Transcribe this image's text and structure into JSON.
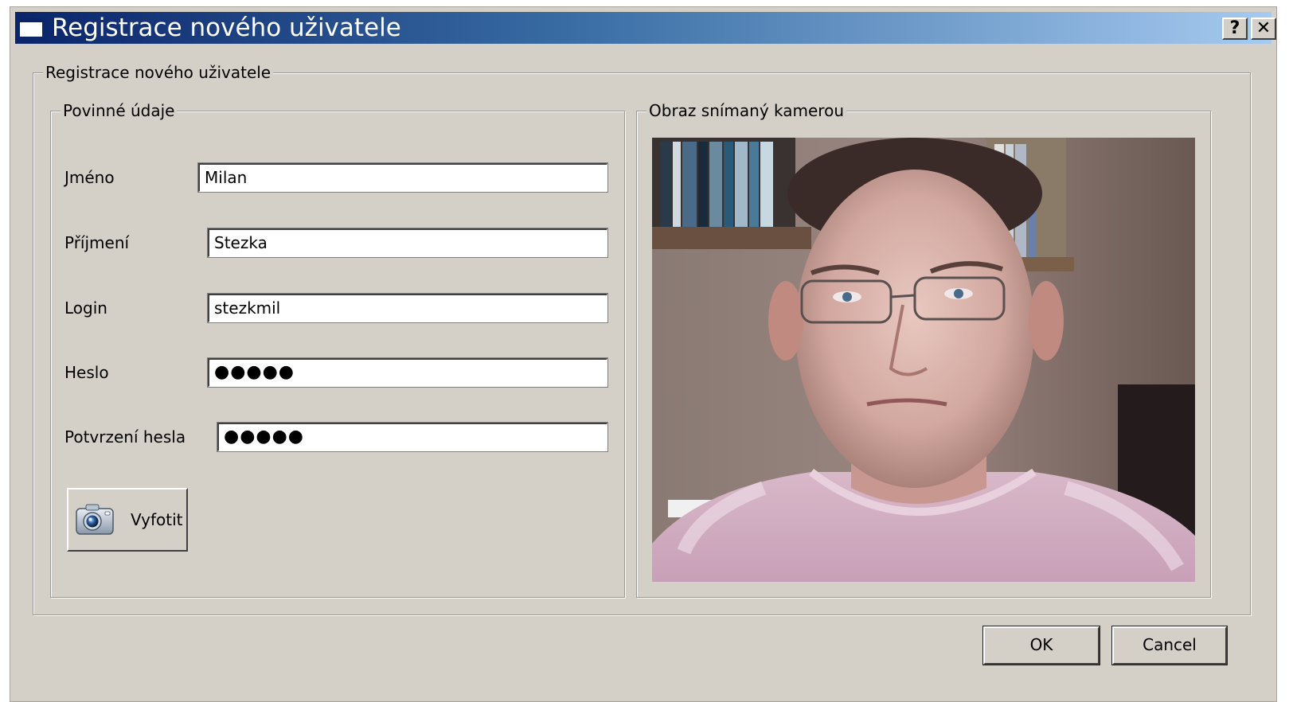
{
  "window": {
    "title": "Registrace nového uživatele",
    "help_label": "?",
    "close_label": "✕"
  },
  "form": {
    "group_title": "Registrace nového uživatele",
    "required": {
      "title": "Povinné údaje",
      "fields": [
        {
          "label": "Jméno",
          "value": "Milan"
        },
        {
          "label": "Příjmení",
          "value": "Stezka"
        },
        {
          "label": "Login",
          "value": "stezkmil"
        },
        {
          "label": "Heslo",
          "value": "●●●●●"
        },
        {
          "label": "Potvrzení hesla",
          "value": "●●●●●"
        }
      ],
      "photo_button_label": "Vyfotit"
    },
    "camera": {
      "title": "Obraz snímaný kamerou"
    }
  },
  "buttons": {
    "ok_label": "OK",
    "cancel_label": "Cancel"
  },
  "icons": {
    "window_icon": "window-icon",
    "camera_icon": "camera-icon"
  },
  "colors": {
    "titlebar_start": "#0a246a",
    "titlebar_end": "#a6caf0",
    "dialog_background": "#d4d0c8"
  }
}
